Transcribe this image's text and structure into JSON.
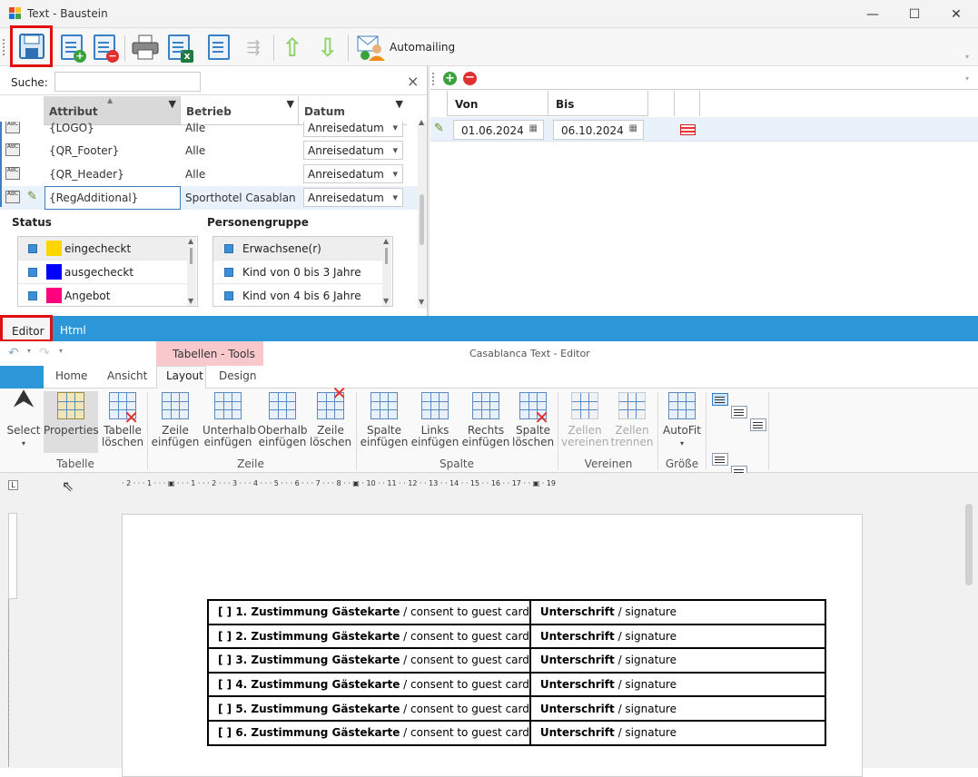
{
  "window": {
    "title": "Text - Baustein",
    "controls": [
      "—",
      "☐",
      "✕"
    ]
  },
  "toolbar": {
    "automailing_label": "Automailing"
  },
  "search": {
    "label": "Suche:",
    "value": "",
    "clear": "×"
  },
  "grid": {
    "headers": [
      "Attribut",
      "Betrieb",
      "Datum"
    ],
    "rows": [
      {
        "icon": "ABC",
        "attribut": "{LOGO}",
        "betrieb": "Alle",
        "datum": "Anreisedatum"
      },
      {
        "icon": "ABC",
        "attribut": "{QR_Footer}",
        "betrieb": "Alle",
        "datum": "Anreisedatum"
      },
      {
        "icon": "ABC",
        "attribut": "{QR_Header}",
        "betrieb": "Alle",
        "datum": "Anreisedatum"
      },
      {
        "icon": "ABC",
        "attribut": "{RegAdditional}",
        "betrieb": "Sporthotel Casablanca",
        "datum": "Anreisedatum"
      }
    ]
  },
  "status": {
    "title": "Status",
    "items": [
      {
        "label": "eingecheckt",
        "color": "#ffd600"
      },
      {
        "label": "ausgecheckt",
        "color": "#0000ff"
      },
      {
        "label": "Angebot",
        "color": "#ff007f"
      }
    ]
  },
  "personengruppe": {
    "title": "Personengruppe",
    "items": [
      "Erwachsene(r)",
      "Kind von 0 bis 3 Jahre",
      "Kind von 4 bis 6 Jahre"
    ]
  },
  "dates": {
    "headers": [
      "Von",
      "Bis"
    ],
    "von": "01.06.2024",
    "bis": "06.10.2024"
  },
  "editor_tabs": [
    "Editor",
    "Html"
  ],
  "ribbon": {
    "context_tab": "Tabellen - Tools",
    "editor_title": "Casablanca Text - Editor",
    "tabs": [
      "Home",
      "Ansicht",
      "Layout",
      "Design"
    ],
    "groups": [
      "Tabelle",
      "Zeile",
      "Spalte",
      "Vereinen",
      "Größe"
    ],
    "buttons": {
      "select": "Select",
      "properties": "Properties",
      "tabelle_loeschen": [
        "Tabelle",
        "löschen"
      ],
      "zeile_einfuegen": [
        "Zeile",
        "einfügen"
      ],
      "unterhalb": [
        "Unterhalb",
        "einfügen"
      ],
      "oberhalb": [
        "Oberhalb",
        "einfügen"
      ],
      "zeile_loeschen": [
        "Zeile",
        "löschen"
      ],
      "spalte_einfuegen": [
        "Spalte",
        "einfügen"
      ],
      "links": [
        "Links",
        "einfügen"
      ],
      "rechts": [
        "Rechts",
        "einfügen"
      ],
      "spalte_loeschen": [
        "Spalte",
        "löschen"
      ],
      "zellen_verbinden": [
        "Zellen",
        "vereinen"
      ],
      "zellen_trennen": [
        "Zellen",
        "trennen"
      ],
      "autofit": "AutoFit"
    }
  },
  "ruler_text": "· 2 · · · 1 · · · ▣ · · · 1 · · · 2 · · · 3 · · · 4 · · · 5 · · · 6 · · · 7 · · · 8 · · ▣ · 10 · · 11 · · 12 · · 13 · · 14 · · 15 · · 16 · · 17 · · ▣ · 19",
  "document": {
    "rows": [
      {
        "prefix": "[  ] ",
        "bold": "1. Zustimmung Gästekarte",
        "rest": " / consent to guest card",
        "sig_bold": "Unterschrift",
        "sig_rest": " / signature"
      },
      {
        "prefix": "[  ] ",
        "bold": "2. Zustimmung Gästekarte",
        "rest": " / consent to guest card",
        "sig_bold": "Unterschrift",
        "sig_rest": " / signature"
      },
      {
        "prefix": "[  ] ",
        "bold": "3. Zustimmung Gästekarte",
        "rest": " / consent to guest card",
        "sig_bold": "Unterschrift",
        "sig_rest": " / signature"
      },
      {
        "prefix": "[  ] ",
        "bold": "4. Zustimmung Gästekarte",
        "rest": " / consent to guest card",
        "sig_bold": "Unterschrift",
        "sig_rest": " / signature"
      },
      {
        "prefix": "[  ] ",
        "bold": "5. Zustimmung Gästekarte",
        "rest": " / consent to guest card",
        "sig_bold": "Unterschrift",
        "sig_rest": " / signature"
      },
      {
        "prefix": "[  ] ",
        "bold": "6. Zustimmung Gästekarte",
        "rest": " / consent to guest card",
        "sig_bold": "Unterschrift",
        "sig_rest": " / signature"
      }
    ]
  }
}
